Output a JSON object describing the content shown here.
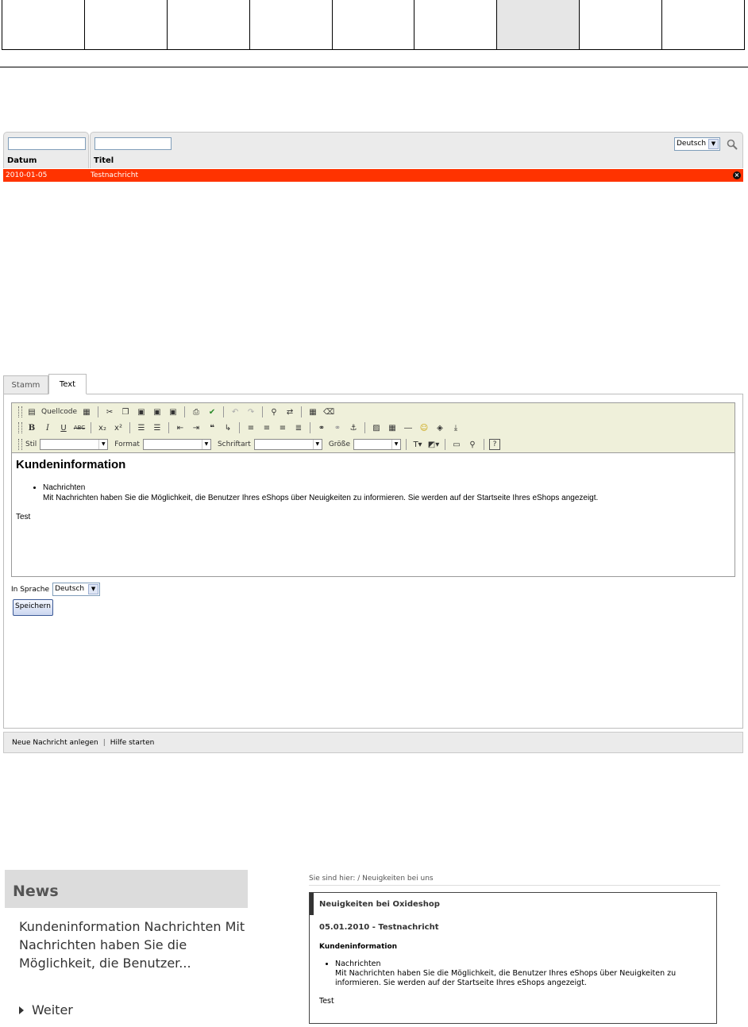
{
  "list": {
    "columns": [
      "Datum",
      "Titel"
    ],
    "language": "Deutsch",
    "rows": [
      {
        "date": "2010-01-05",
        "title": "Testnachricht"
      }
    ]
  },
  "tabs": [
    {
      "label": "Stamm"
    },
    {
      "label": "Text"
    }
  ],
  "toolbar": {
    "source_label": "Quellcode",
    "style_label": "Stil",
    "format_label": "Format",
    "font_label": "Schriftart",
    "size_label": "Größe"
  },
  "editor": {
    "heading": "Kundeninformation",
    "bullet_title": "Nachrichten",
    "bullet_text": "Mit Nachrichten haben Sie die Möglichkeit, die Benutzer Ihres eShops über Neuigkeiten zu informieren. Sie werden auf der Startseite Ihres eShops angezeigt.",
    "extra": "Test"
  },
  "language_label": "In Sprache",
  "language_value": "Deutsch",
  "save_label": "Speichern",
  "bottom_links": [
    "Neue Nachricht anlegen",
    "Hilfe starten"
  ],
  "news_box": {
    "title": "News",
    "teaser": "Kundeninformation Nachrichten Mit Nachrichten haben Sie die Möglichkeit, die Benutzer...",
    "more": "Weiter"
  },
  "detail": {
    "breadcrumb": "Sie sind hier: / Neuigkeiten bei uns",
    "title": "Neuigkeiten bei Oxideshop",
    "subtitle": "05.01.2010 - Testnachricht",
    "heading": "Kundeninformation",
    "bullet_title": "Nachrichten",
    "bullet_text": "Mit Nachrichten haben Sie die Möglichkeit, die Benutzer Ihres eShops über Neuigkeiten zu informieren. Sie werden auf der Startseite Ihres eShops angezeigt.",
    "extra": "Test"
  },
  "colors": {
    "accent_row": "#ff3300",
    "toolbar_bg": "#eff0da"
  }
}
